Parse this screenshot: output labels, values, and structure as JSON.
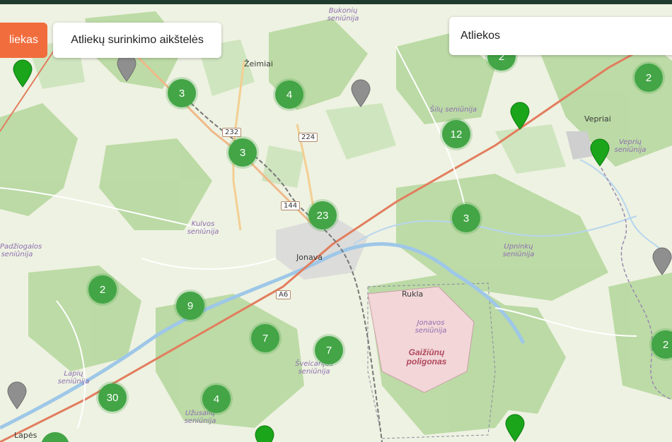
{
  "header": {
    "filter_active_label": "liekas",
    "filter_sites_label": "Atliekų surinkimo aikštelės"
  },
  "search": {
    "value": "Atliekos"
  },
  "colors": {
    "cluster": "#43a546",
    "pin_active": "#1aa51a",
    "pin_inactive": "#8f8f8f",
    "accent": "#f26d3d"
  },
  "map": {
    "towns": [
      "Žeimiai",
      "Vepriai",
      "Jonava",
      "Rukla",
      "Lapės"
    ],
    "wards": [
      "Bukonių seniūnija",
      "Šilų seniūnija",
      "Veprių seniūnija",
      "Kulvos seniūnija",
      "Upninkų seniūnija",
      "Jonavos seniūnija",
      "Šveicarijos seniūnija",
      "Lapių seniūnija",
      "Užusalių seniūnija",
      "Padžiogalos seniūnija"
    ],
    "roads": [
      "232",
      "224",
      "144",
      "A6"
    ],
    "poligon": "Gaižiūnų poligonas",
    "clusters": [
      "3",
      "4",
      "3",
      "23",
      "12",
      "3",
      "2",
      "2",
      "9",
      "7",
      "7",
      "30",
      "4",
      "2",
      "2"
    ]
  }
}
